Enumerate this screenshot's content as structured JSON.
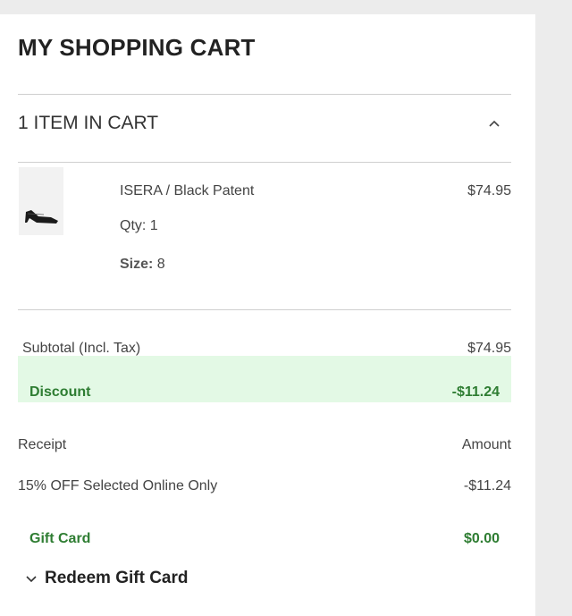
{
  "cart": {
    "title": "MY SHOPPING CART",
    "items_header": "1 ITEM IN CART",
    "items": [
      {
        "name": "ISERA / Black Patent",
        "qty": "Qty: 1",
        "size_label": "Size:",
        "size_value": "8",
        "price": "$74.95"
      }
    ]
  },
  "summary": {
    "subtotal_label": "Subtotal (Incl. Tax)",
    "subtotal_value": "$74.95",
    "discount_label": "Discount",
    "discount_value": "-$11.24",
    "receipt_header": "Receipt",
    "amount_header": "Amount",
    "promo_label": "15% OFF Selected Online Only",
    "promo_value": "-$11.24",
    "giftcard_label": "Gift Card",
    "giftcard_value": "$0.00",
    "redeem_label": "Redeem Gift Card"
  },
  "colors": {
    "discount_bg": "#e3f9e5",
    "discount_text": "#2e7d32"
  },
  "icons": {
    "collapse": "chevron-up-icon",
    "expand": "chevron-down-icon",
    "product": "shoe-thumbnail"
  }
}
